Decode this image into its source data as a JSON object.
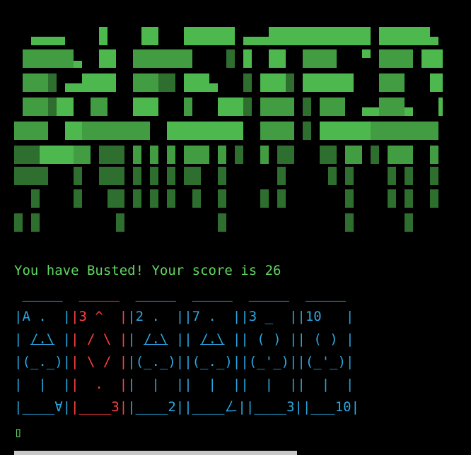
{
  "colors": {
    "background": "#000000",
    "banner": "#4db84d",
    "message": "#5fd75f",
    "black_card": "#2aa8e0",
    "red_card": "#ff4040",
    "cursor": "#5fd75f"
  },
  "message": "You have Busted! Your score is 26",
  "cursor_glyph": "▯",
  "cards": [
    {
      "color": "black_card",
      "lines": [
        " _____ ",
        "|A .  |",
        "| /.\\ |",
        "|(_._)|",
        "|  |  |",
        "|____∀|"
      ]
    },
    {
      "color": "red_card",
      "lines": [
        " _____ ",
        "|3 ^  |",
        "| / \\ |",
        "| \\ / |",
        "|  .  |",
        "|____3|"
      ]
    },
    {
      "color": "black_card",
      "lines": [
        " _____ ",
        "|2 .  |",
        "| /.\\ |",
        "|(_._)|",
        "|  |  |",
        "|____2|"
      ]
    },
    {
      "color": "black_card",
      "lines": [
        " _____ ",
        "|7 .  |",
        "| /.\\ |",
        "|(_._)|",
        "|  |  |",
        "|____ㄥ|"
      ]
    },
    {
      "color": "black_card",
      "lines": [
        " _____ ",
        "|3 _  |",
        "| ( ) |",
        "|(_'_)|",
        "|  |  |",
        "|____3|"
      ]
    },
    {
      "color": "black_card",
      "lines": [
        " _____ ",
        "|10   |",
        "| ( ) |",
        "|(_'_)|",
        "|  |  |",
        "|___10|"
      ]
    }
  ]
}
